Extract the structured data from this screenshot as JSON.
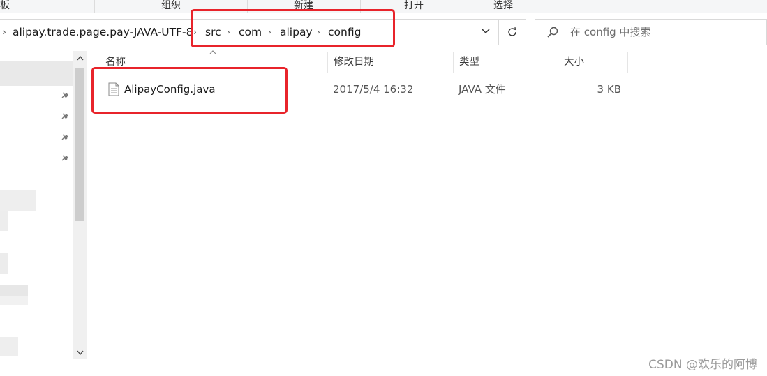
{
  "ribbon": {
    "groups": [
      {
        "label": "板"
      },
      {
        "label": "组织"
      },
      {
        "label": "新建"
      },
      {
        "label": "打开"
      },
      {
        "label": "选择"
      }
    ]
  },
  "address_bar": {
    "crumbs": [
      {
        "label": "alipay.trade.page.pay-JAVA-UTF-8"
      },
      {
        "label": "src"
      },
      {
        "label": "com"
      },
      {
        "label": "alipay"
      },
      {
        "label": "config"
      }
    ],
    "separator": "›",
    "dropdown_icon": "chevron-down-icon",
    "refresh_icon": "refresh-icon"
  },
  "search": {
    "placeholder": "在 config 中搜索",
    "icon": "search-icon"
  },
  "columns": {
    "name": "名称",
    "modified": "修改日期",
    "type": "类型",
    "size": "大小"
  },
  "files": [
    {
      "name": "AlipayConfig.java",
      "modified": "2017/5/4 16:32",
      "type": "JAVA 文件",
      "size": "3 KB",
      "icon": "document-icon"
    }
  ],
  "nav_pane": {
    "pin_icon": "pin-icon",
    "scroll_up": "^",
    "scroll_down": "v"
  },
  "watermark": "CSDN @欢乐的阿博",
  "colors": {
    "highlight": "#e8242b",
    "ribbon_bg": "#f5f6f7",
    "border": "#d9d9d9"
  }
}
